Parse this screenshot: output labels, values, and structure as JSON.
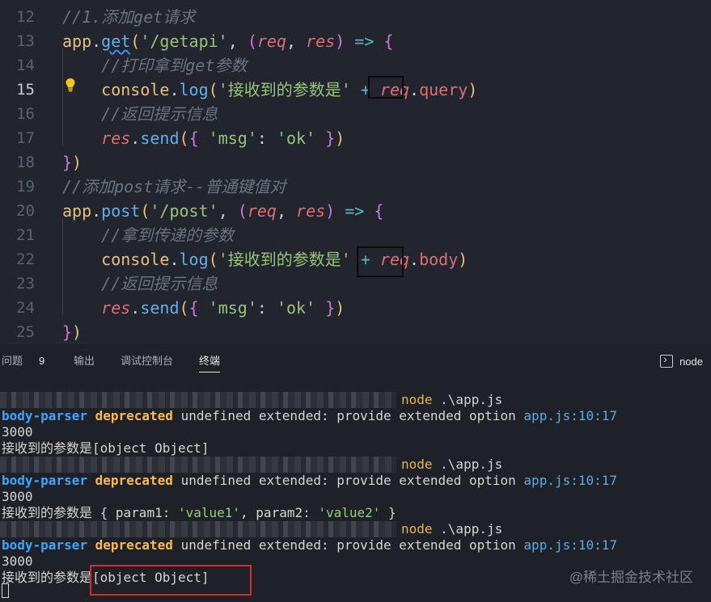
{
  "editor": {
    "lines": [
      {
        "num": "12",
        "tokens": [
          [
            "c-cmt",
            "//1.添加get请求"
          ]
        ]
      },
      {
        "num": "13",
        "tokens": [
          [
            "c-obj",
            "app"
          ],
          [
            "c-punc",
            "."
          ],
          [
            "c-fn",
            "get"
          ],
          [
            "c-p1",
            "("
          ],
          [
            "c-str",
            "'/getapi'"
          ],
          [
            "c-punc",
            ", "
          ],
          [
            "c-p2",
            "("
          ],
          [
            "c-par",
            "req"
          ],
          [
            "c-punc",
            ", "
          ],
          [
            "c-par",
            "res"
          ],
          [
            "c-p2",
            ")"
          ],
          [
            "c-punc",
            " "
          ],
          [
            "c-op",
            "=>"
          ],
          [
            "c-punc",
            " "
          ],
          [
            "c-p2",
            "{"
          ]
        ]
      },
      {
        "num": "14",
        "tokens": [
          [
            "c-cmt",
            "    //打印拿到get参数"
          ]
        ]
      },
      {
        "num": "15",
        "tokens": [
          [
            "c-punc",
            "    "
          ],
          [
            "c-obj",
            "console"
          ],
          [
            "c-punc",
            "."
          ],
          [
            "c-fn",
            "log"
          ],
          [
            "c-p1",
            "("
          ],
          [
            "c-str",
            "'接收到的参数是'"
          ],
          [
            "c-punc",
            " "
          ],
          [
            "c-op",
            "+"
          ],
          [
            "c-punc",
            " "
          ],
          [
            "c-par",
            "req"
          ],
          [
            "c-punc",
            "."
          ],
          [
            "c-prop",
            "query"
          ],
          [
            "c-p1",
            ")"
          ]
        ]
      },
      {
        "num": "16",
        "tokens": [
          [
            "c-cmt",
            "    //返回提示信息"
          ]
        ]
      },
      {
        "num": "17",
        "tokens": [
          [
            "c-punc",
            "    "
          ],
          [
            "c-par",
            "res"
          ],
          [
            "c-punc",
            "."
          ],
          [
            "c-fn",
            "send"
          ],
          [
            "c-p1",
            "("
          ],
          [
            "c-p2",
            "{"
          ],
          [
            "c-punc",
            " "
          ],
          [
            "c-str",
            "'msg'"
          ],
          [
            "c-punc",
            ": "
          ],
          [
            "c-str",
            "'ok'"
          ],
          [
            "c-punc",
            " "
          ],
          [
            "c-p2",
            "}"
          ],
          [
            "c-p1",
            ")"
          ]
        ]
      },
      {
        "num": "18",
        "tokens": [
          [
            "c-p2",
            "}"
          ],
          [
            "c-p1",
            ")"
          ]
        ]
      },
      {
        "num": "19",
        "tokens": [
          [
            "c-cmt",
            "//添加post请求--普通键值对"
          ]
        ]
      },
      {
        "num": "20",
        "tokens": [
          [
            "c-obj",
            "app"
          ],
          [
            "c-punc",
            "."
          ],
          [
            "c-fn",
            "post"
          ],
          [
            "c-p1",
            "("
          ],
          [
            "c-str",
            "'/post'"
          ],
          [
            "c-punc",
            ", "
          ],
          [
            "c-p2",
            "("
          ],
          [
            "c-par",
            "req"
          ],
          [
            "c-punc",
            ", "
          ],
          [
            "c-par",
            "res"
          ],
          [
            "c-p2",
            ")"
          ],
          [
            "c-punc",
            " "
          ],
          [
            "c-op",
            "=>"
          ],
          [
            "c-punc",
            " "
          ],
          [
            "c-p2",
            "{"
          ]
        ]
      },
      {
        "num": "21",
        "tokens": [
          [
            "c-cmt",
            "    //拿到传递的参数"
          ]
        ]
      },
      {
        "num": "22",
        "tokens": [
          [
            "c-punc",
            "    "
          ],
          [
            "c-obj",
            "console"
          ],
          [
            "c-punc",
            "."
          ],
          [
            "c-fn",
            "log"
          ],
          [
            "c-p1",
            "("
          ],
          [
            "c-str",
            "'接收到的参数是'"
          ],
          [
            "c-punc",
            " "
          ],
          [
            "c-op",
            "+"
          ],
          [
            "c-punc",
            " "
          ],
          [
            "c-par",
            "req"
          ],
          [
            "c-punc",
            "."
          ],
          [
            "c-prop",
            "body"
          ],
          [
            "c-p1",
            ")"
          ]
        ]
      },
      {
        "num": "23",
        "tokens": [
          [
            "c-cmt",
            "    //返回提示信息"
          ]
        ]
      },
      {
        "num": "24",
        "tokens": [
          [
            "c-punc",
            "    "
          ],
          [
            "c-par",
            "res"
          ],
          [
            "c-punc",
            "."
          ],
          [
            "c-fn",
            "send"
          ],
          [
            "c-p1",
            "("
          ],
          [
            "c-p2",
            "{"
          ],
          [
            "c-punc",
            " "
          ],
          [
            "c-str",
            "'msg'"
          ],
          [
            "c-punc",
            ": "
          ],
          [
            "c-str",
            "'ok'"
          ],
          [
            "c-punc",
            " "
          ],
          [
            "c-p2",
            "}"
          ],
          [
            "c-p1",
            ")"
          ]
        ]
      },
      {
        "num": "25",
        "tokens": [
          [
            "c-p2",
            "}"
          ],
          [
            "c-p1",
            ")"
          ]
        ]
      }
    ],
    "current_line": "15"
  },
  "panel": {
    "tabs": [
      {
        "label": "问题"
      },
      {
        "label": "输出"
      },
      {
        "label": "调试控制台"
      },
      {
        "label": "终端"
      }
    ],
    "problems_count": "9",
    "active_tab": "终端",
    "terminal_name": "node"
  },
  "terminal": {
    "cmd": "node",
    "cmd_arg": " .\\app.js",
    "bp": "body-parser",
    "dep": "deprecated",
    "dep_msg": " undefined extended: provide extended option ",
    "dep_link": "app.js:10:17",
    "port": "3000",
    "out1": "接收到的参数是[object Object]",
    "out2_prefix": "接收到的参数是 ",
    "out2_obj": [
      "{ param1: ",
      "'value1'",
      ", param2: ",
      "'value2'",
      " }"
    ],
    "out3_prefix": "接收到的参数是",
    "out3_value": "[object Object]"
  },
  "watermark": "@稀土掘金技术社区",
  "icons": {
    "bulb": "lightbulb-icon",
    "terminal": "terminal-icon"
  }
}
